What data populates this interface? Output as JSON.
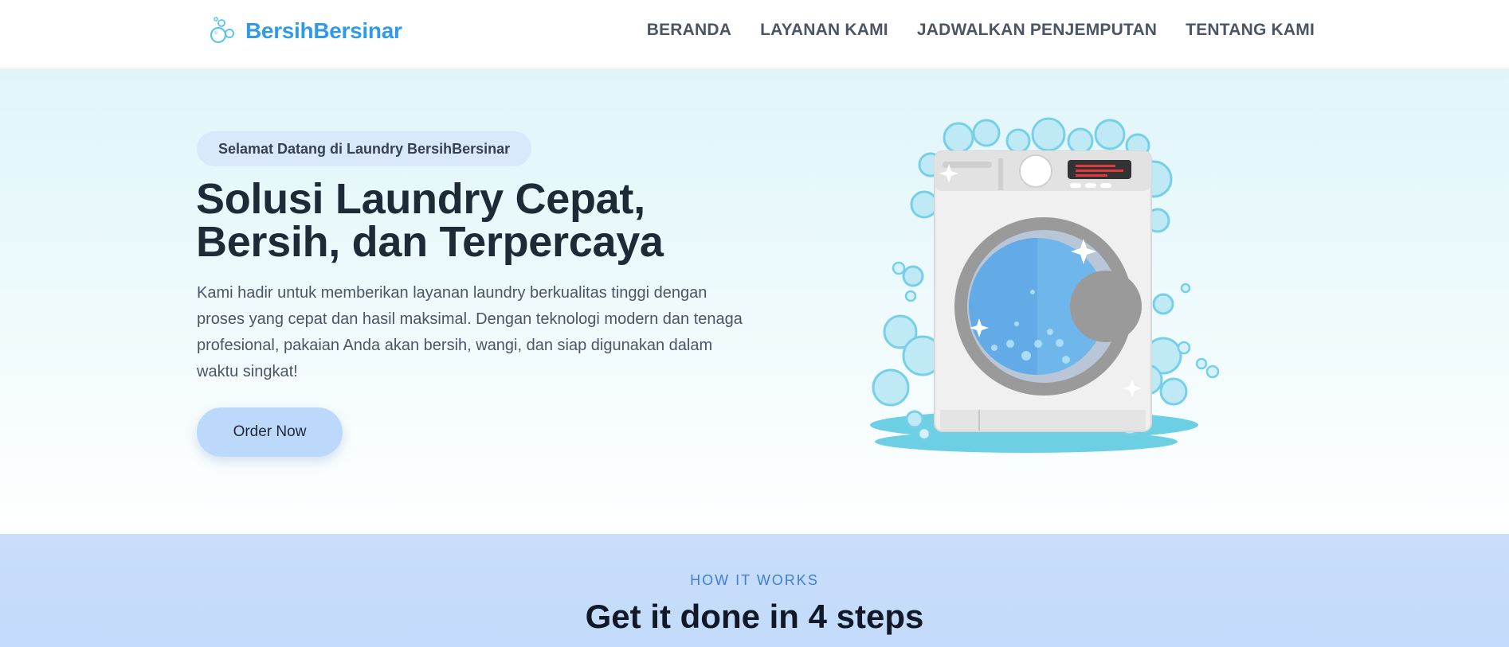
{
  "header": {
    "brand": "BersihBersinar",
    "brand_logo_icon": "bubbles-icon",
    "nav": [
      {
        "label": "BERANDA"
      },
      {
        "label": "LAYANAN KAMI"
      },
      {
        "label": "JADWALKAN PENJEMPUTAN"
      },
      {
        "label": "TENTANG KAMI"
      }
    ]
  },
  "hero": {
    "badge": "Selamat Datang di Laundry BersihBersinar",
    "title_line1": "Solusi Laundry Cepat,",
    "title_line2": "Bersih, dan Terpercaya",
    "description": "Kami hadir untuk memberikan layanan laundry berkualitas tinggi dengan proses yang cepat dan hasil maksimal. Dengan teknologi modern dan tenaga profesional, pakaian Anda akan bersih, wangi, dan siap digunakan dalam waktu singkat!",
    "cta": "Order Now",
    "illustration": "washing-machine-illustration"
  },
  "steps": {
    "kicker": "HOW IT WORKS",
    "title": "Get it done in 4 steps"
  },
  "colors": {
    "brand": "#2f9be8",
    "hero_bg": "#e0f5fa",
    "badge_bg": "#d9e8fb",
    "cta_bg": "#bcd8fb",
    "steps_bg": "#c8defb",
    "kicker": "#3f7fd8"
  }
}
